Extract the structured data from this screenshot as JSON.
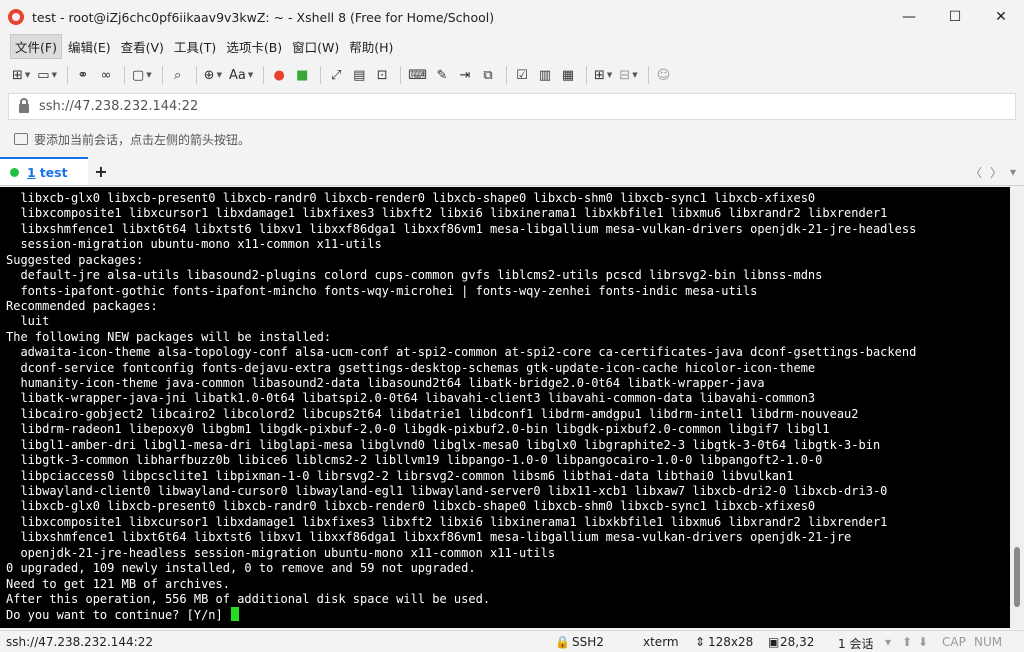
{
  "window": {
    "title": "test - root@iZj6chc0pf6iikaav9v3kwZ: ~ - Xshell 8 (Free for Home/School)",
    "minimize": "—",
    "maximize": "☐",
    "close": "✕"
  },
  "menu": [
    {
      "label": "文件(F)"
    },
    {
      "label": "编辑(E)"
    },
    {
      "label": "查看(V)"
    },
    {
      "label": "工具(T)"
    },
    {
      "label": "选项卡(B)"
    },
    {
      "label": "窗口(W)"
    },
    {
      "label": "帮助(H)"
    }
  ],
  "toolbar": {
    "new_session_icon": "new-session-icon",
    "open_icon": "folder-icon",
    "font_label": "Aa",
    "icons": [
      "new-session-icon",
      "folder-icon",
      "link-icon",
      "unlink-icon",
      "screen-icon",
      "search-icon",
      "globe-icon",
      "font-icon",
      "xshell-icon",
      "xftp-icon",
      "fullscreen-icon",
      "transparency-icon",
      "lock-icon",
      "keyboard-icon",
      "pen-icon",
      "send-icon",
      "script-icon",
      "compose-icon",
      "multi-icon",
      "layout-icon",
      "tab-add-icon",
      "split-icon",
      "help-icon"
    ]
  },
  "address": {
    "value": "ssh://47.238.232.144:22"
  },
  "hint": {
    "text": "要添加当前会话，点击左侧的箭头按钮。"
  },
  "tabs": [
    {
      "number": "1",
      "name": "test",
      "status_color": "#21c040"
    }
  ],
  "tabnav": {
    "prev": "〈",
    "next": "〉",
    "menu": "▾"
  },
  "terminal": {
    "lines": [
      "  libxcb-glx0 libxcb-present0 libxcb-randr0 libxcb-render0 libxcb-shape0 libxcb-shm0 libxcb-sync1 libxcb-xfixes0",
      "  libxcomposite1 libxcursor1 libxdamage1 libxfixes3 libxft2 libxi6 libxinerama1 libxkbfile1 libxmu6 libxrandr2 libxrender1",
      "  libxshmfence1 libxt6t64 libxtst6 libxv1 libxxf86dga1 libxxf86vm1 mesa-libgallium mesa-vulkan-drivers openjdk-21-jre-headless",
      "  session-migration ubuntu-mono x11-common x11-utils",
      "Suggested packages:",
      "  default-jre alsa-utils libasound2-plugins colord cups-common gvfs liblcms2-utils pcscd librsvg2-bin libnss-mdns",
      "  fonts-ipafont-gothic fonts-ipafont-mincho fonts-wqy-microhei | fonts-wqy-zenhei fonts-indic mesa-utils",
      "Recommended packages:",
      "  luit",
      "The following NEW packages will be installed:",
      "  adwaita-icon-theme alsa-topology-conf alsa-ucm-conf at-spi2-common at-spi2-core ca-certificates-java dconf-gsettings-backend",
      "  dconf-service fontconfig fonts-dejavu-extra gsettings-desktop-schemas gtk-update-icon-cache hicolor-icon-theme",
      "  humanity-icon-theme java-common libasound2-data libasound2t64 libatk-bridge2.0-0t64 libatk-wrapper-java",
      "  libatk-wrapper-java-jni libatk1.0-0t64 libatspi2.0-0t64 libavahi-client3 libavahi-common-data libavahi-common3",
      "  libcairo-gobject2 libcairo2 libcolord2 libcups2t64 libdatrie1 libdconf1 libdrm-amdgpu1 libdrm-intel1 libdrm-nouveau2",
      "  libdrm-radeon1 libepoxy0 libgbm1 libgdk-pixbuf-2.0-0 libgdk-pixbuf2.0-bin libgdk-pixbuf2.0-common libgif7 libgl1",
      "  libgl1-amber-dri libgl1-mesa-dri libglapi-mesa libglvnd0 libglx-mesa0 libglx0 libgraphite2-3 libgtk-3-0t64 libgtk-3-bin",
      "  libgtk-3-common libharfbuzz0b libice6 liblcms2-2 libllvm19 libpango-1.0-0 libpangocairo-1.0-0 libpangoft2-1.0-0",
      "  libpciaccess0 libpcsclite1 libpixman-1-0 librsvg2-2 librsvg2-common libsm6 libthai-data libthai0 libvulkan1",
      "  libwayland-client0 libwayland-cursor0 libwayland-egl1 libwayland-server0 libx11-xcb1 libxaw7 libxcb-dri2-0 libxcb-dri3-0",
      "  libxcb-glx0 libxcb-present0 libxcb-randr0 libxcb-render0 libxcb-shape0 libxcb-shm0 libxcb-sync1 libxcb-xfixes0",
      "  libxcomposite1 libxcursor1 libxdamage1 libxfixes3 libxft2 libxi6 libxinerama1 libxkbfile1 libxmu6 libxrandr2 libxrender1",
      "  libxshmfence1 libxt6t64 libxtst6 libxv1 libxxf86dga1 libxxf86vm1 mesa-libgallium mesa-vulkan-drivers openjdk-21-jre",
      "  openjdk-21-jre-headless session-migration ubuntu-mono x11-common x11-utils",
      "0 upgraded, 109 newly installed, 0 to remove and 59 not upgraded.",
      "Need to get 121 MB of archives.",
      "After this operation, 556 MB of additional disk space will be used.",
      "Do you want to continue? [Y/n] "
    ],
    "cursor_color": "#22dd22"
  },
  "status": {
    "connection": "ssh://47.238.232.144:22",
    "protocol": "SSH2",
    "term": "xterm",
    "size": "128x28",
    "cursor_pos": "28,32",
    "sessions": "1 会话",
    "cap": "CAP",
    "num": "NUM"
  }
}
